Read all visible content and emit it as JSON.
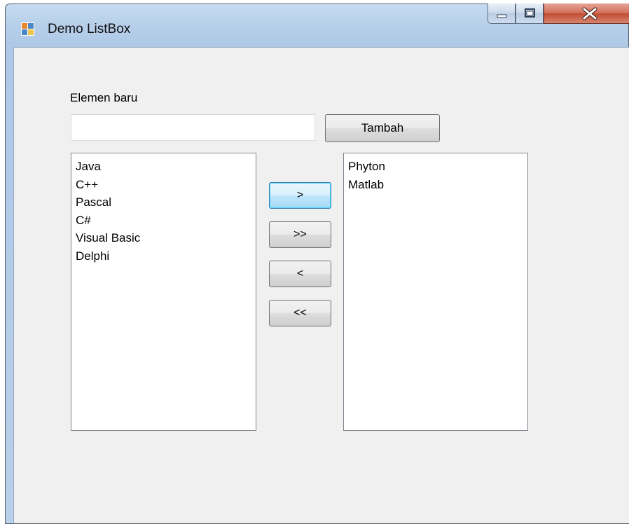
{
  "window": {
    "title": "Demo ListBox",
    "icon": "windows-form-icon"
  },
  "caption_buttons": {
    "minimize_icon": "minimize-icon",
    "maximize_icon": "maximize-icon",
    "close_icon": "close-icon"
  },
  "form": {
    "label": "Elemen baru",
    "input_value": "",
    "add_button": "Tambah",
    "move_buttons": [
      ">",
      ">>",
      "<",
      "<<"
    ],
    "left_list": [
      "Java",
      "C++",
      "Pascal",
      "C#",
      "Visual Basic",
      "Delphi"
    ],
    "right_list": [
      "Phyton",
      "Matlab"
    ]
  },
  "colors": {
    "client_bg": "#f0f0f0",
    "titlebar": "#b9d0ea",
    "close_button": "#c24d33"
  }
}
